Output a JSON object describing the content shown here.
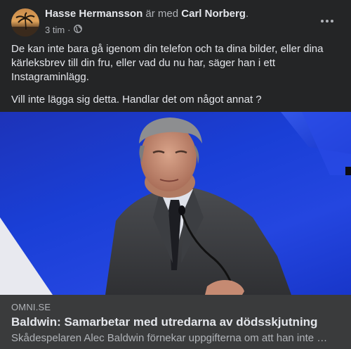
{
  "post": {
    "author": "Hasse Hermansson",
    "with_text": "är med",
    "tagged": "Carl Norberg",
    "period": ".",
    "time": "3 tim",
    "separator": "·",
    "privacy_icon": "globe-icon",
    "more_icon": "more-horizontal-icon",
    "body_paragraphs": [
      "De kan inte bara gå igenom din telefon och ta dina bilder, eller dina kärleksbrev till din fru, eller vad du nu har, säger han i ett Instagraminlägg.",
      "Vill inte lägga sig detta. Handlar det om något annat ?"
    ]
  },
  "link_preview": {
    "domain": "OMNI.SE",
    "title": "Baldwin: Samarbetar med utredarna av dödsskjutning",
    "description": "Skådespelaren Alec Baldwin förnekar uppgifterna om att han inte har samarbetat med utredningen"
  },
  "colors": {
    "background": "#242526",
    "link_bg": "#3a3b3c",
    "text_primary": "#e4e6eb",
    "text_secondary": "#b0b3b8",
    "image_blue": "#1a3fd6"
  }
}
